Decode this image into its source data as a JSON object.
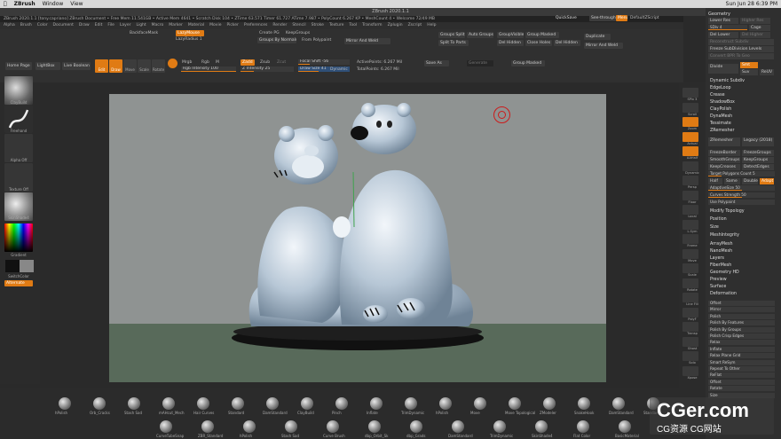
{
  "mac_menu": {
    "app": "ZBrush",
    "window": "Window",
    "view": "View",
    "clock": "Sun Jun 28 6:39 PM"
  },
  "window_title": "ZBrush 2020.1.1",
  "info_bar": "ZBrush 2020.1.1 [tony.capriano] ZBrush Document  •  Free Mem 11.541GB • Active Mem 4641 • Scratch Disk 104 • ZTime 63.571 Timer 61.727 ATime 7.987 • PolyCount 6.267 KP • MeshCount 4 • Welcome 72/49 MB",
  "menu": [
    "Alpha",
    "Brush",
    "Color",
    "Document",
    "Draw",
    "Edit",
    "File",
    "Layer",
    "Light",
    "Macro",
    "Marker",
    "Material",
    "Movie",
    "Picker",
    "Preferences",
    "Render",
    "Stencil",
    "Stroke",
    "Texture",
    "Tool",
    "Transform",
    "Zplugin",
    "Zscript",
    "Help"
  ],
  "top_right": {
    "quicksave": "QuickSave",
    "seethrough": "See-through  0",
    "menus": "Menus",
    "default_zscript": "DefaultZScript"
  },
  "top_shelf": {
    "backface_mask": "BackfaceMask",
    "lazy_mouse": "LazyMouse",
    "lazy_radius": "LazyRadius 1",
    "create_pg": "Create PG",
    "keep_groups": "KeepGroups",
    "groups_by_normals": "Groups By Normals",
    "from_polypaint": "From Polypaint",
    "mirror_and_weld": "Mirror And Weld",
    "groups_split": "Groups Split",
    "auto_groups": "Auto Groups",
    "group_visible": "GroupVisible",
    "group_masked": "Group Masked",
    "duplicate": "Duplicate",
    "split_to_parts": "Split To Parts",
    "del_hidden": "Del Hidden",
    "close_holes": "Close Holes",
    "del_hidden2": "Del Hidden",
    "mirror_and_weld2": "Mirror And Weld",
    "home_page": "Home Page",
    "lightbox": "LightBox",
    "live_boolean": "Live Boolean",
    "edit": "Edit",
    "draw": "Draw",
    "move": "Move",
    "scale": "Scale",
    "rotate": "Rotate",
    "mrgb": "Mrgb",
    "rgb": "Rgb",
    "m": "M",
    "rgb_intensity": "Rgb Intensity 100",
    "zadd": "Zadd",
    "zsub": "Zsub",
    "zcut": "Zcut",
    "z_intensity": "Z Intensity 25",
    "focal_shift": "Focal Shift -56",
    "draw_size": "Draw Size 41",
    "dynamic": "Dynamic",
    "active_points": "ActivePoints: 6.267 Mil",
    "total_points": "TotalPoints: 6.267 Mil",
    "save_as": "Save As",
    "generate": "Generate",
    "group_masked2": "Group Masked"
  },
  "left_shelf": {
    "brush": "ClayBuild",
    "stroke": "Freehand",
    "alpha": "Alpha Off",
    "texture": "Texture Off",
    "material": "SkinShade4",
    "gradient": "Gradient",
    "switch_color": "SwitchColor",
    "alternate": "Alternate"
  },
  "right_shelf": [
    "SPix 3",
    "Scroll",
    "Zoom",
    "Actual",
    "AAHalf",
    "Dynamic",
    "Persp",
    "Floor",
    "Local",
    "L.Sym",
    "Frame",
    "Move",
    "Scale",
    "Rotate",
    "Line Fill",
    "PolyF",
    "Transp",
    "Ghost",
    "Solo",
    "Xpose"
  ],
  "tray": {
    "header": "Geometry",
    "lower_res": "Lower Res",
    "higher_res": "Higher Res",
    "sdiv": "SDiv 4",
    "cage": "Cage",
    "del_lower": "Del Lower",
    "del_higher": "Del Higher",
    "reconstruct": "Reconstruct Subdiv",
    "freeze": "Freeze SubDivision Levels",
    "convert_bpr": "Convert BPR To Geo",
    "divide": "Divide",
    "smt": "Smt",
    "suv": "Suv",
    "rsmt": "ReUV",
    "items": [
      "Dynamic Subdiv",
      "EdgeLoop",
      "Crease",
      "ShadowBox",
      "ClayPolish",
      "DynaMesh",
      "Tessimate",
      "ZRemesher"
    ],
    "zremesher_btn": "ZRemesher",
    "legacy": "Legacy (2018)",
    "freeze_border": "FreezeBorder",
    "freeze_groups": "FreezeGroups",
    "smooth_groups": "SmoothGroups",
    "keep_groups": "KeepGroups",
    "keep_creases": "KeepCreases",
    "detect_edges": "DetectEdges",
    "target_polys": "Target Polygons Count 5",
    "half": "Half",
    "same": "Same",
    "double": "Double",
    "adapt": "Adapt",
    "adaptive_size": "AdaptiveSize 50",
    "curves_strength": "Curves Strength 50",
    "use_polypaint": "Use Polypaint",
    "modify_topology": "Modify Topology",
    "position": "Position",
    "size": "Size",
    "mesh_integrity": "MeshIntegrity",
    "items2": [
      "ArrayMesh",
      "NanoMesh",
      "Layers",
      "FiberMesh",
      "Geometry HD",
      "Preview",
      "Surface",
      "Deformation"
    ],
    "deformation": [
      "Offset",
      "Mirror",
      "Polish",
      "Polish By Features",
      "Polish By Groups",
      "Polish Crisp Edges",
      "Relax",
      "Inflate",
      "Relax Plane Grid",
      "Smart ReSym",
      "Repeat To Other",
      "ReFlat",
      "Offset",
      "Rotate",
      "Size"
    ]
  },
  "bottom_brushes": {
    "row1": [
      "hPolish",
      "Orb_Cracks",
      "Stash Sad",
      "mAHcut_Mech",
      "Hair Curves",
      "Standard",
      "DamStandard",
      "ClayBuild",
      "Pinch",
      "Inflate",
      "TrimDynamic",
      "hPolish",
      "Move",
      "Move Topological",
      "ZModeler",
      "SnakeHook",
      "DamStandard",
      "Standard"
    ],
    "row2": [
      "CurveTubeSnap",
      "ZBR_Standard",
      "hPolish",
      "Stash Sad",
      "Curve Brush",
      "dbp_Orbit_Sk",
      "dbp_Grads",
      "DamStandard",
      "TrimDynamic",
      "SkinShade4",
      "Flat Color",
      "BasicMaterial"
    ]
  },
  "watermark": {
    "big": "CGer.com",
    "small": "CG资源 CG网站"
  }
}
